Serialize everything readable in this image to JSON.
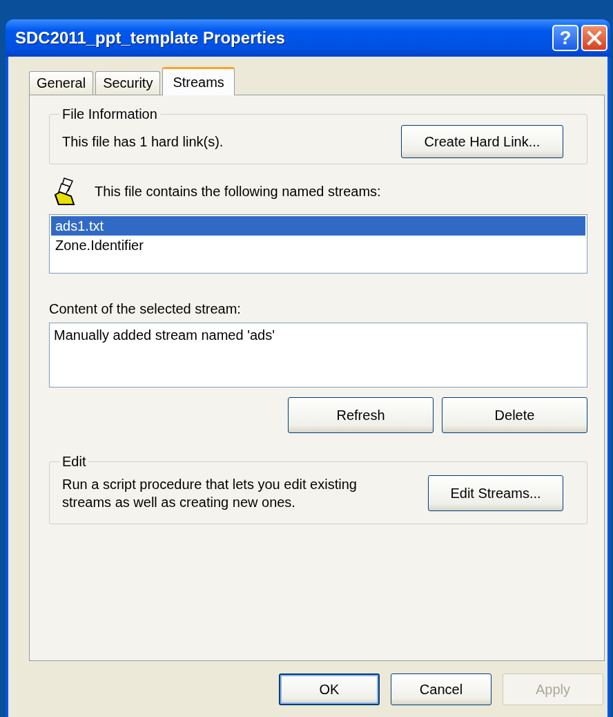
{
  "window": {
    "title": "SDC2011_ppt_template Properties",
    "help_button": "?"
  },
  "tabs": [
    {
      "label": "General",
      "selected": false
    },
    {
      "label": "Security",
      "selected": false
    },
    {
      "label": "Streams",
      "selected": true
    }
  ],
  "file_information": {
    "legend": "File Information",
    "text": "This file has 1 hard link(s).",
    "button": "Create Hard Link..."
  },
  "streams": {
    "label": "This file contains the following named streams:",
    "items": [
      {
        "name": "ads1.txt",
        "selected": true
      },
      {
        "name": "Zone.Identifier",
        "selected": false
      }
    ]
  },
  "content": {
    "label": "Content of the selected stream:",
    "value": "Manually added stream named 'ads'"
  },
  "actions": [
    "Refresh",
    "Delete"
  ],
  "edit": {
    "legend": "Edit",
    "text": "Run a script procedure that lets you edit existing streams as well as creating new ones.",
    "button": "Edit Streams..."
  },
  "dialog_buttons": [
    {
      "label": "OK",
      "default": true,
      "disabled": false
    },
    {
      "label": "Cancel",
      "default": false,
      "disabled": false
    },
    {
      "label": "Apply",
      "default": false,
      "disabled": true
    }
  ]
}
